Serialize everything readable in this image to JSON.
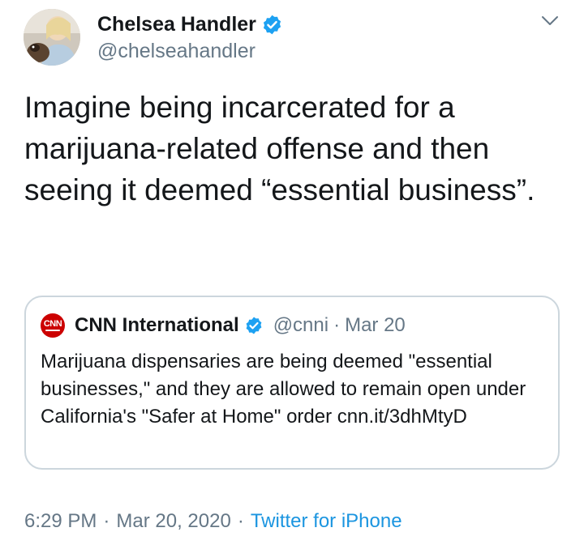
{
  "author": {
    "display_name": "Chelsea Handler",
    "handle": "@chelseahandler"
  },
  "tweet": {
    "text": "Imagine being incarcerated for a marijuana-related offense and then seeing it deemed “essential business”."
  },
  "quoted_tweet": {
    "display_name": "CNN International",
    "handle": "@cnni",
    "separator": "·",
    "date": "Mar 20",
    "logo_text": "CNN",
    "text": "Marijuana dispensaries are being deemed \"essential businesses,\" and they are allowed to remain open under California's \"Safer at Home\" order cnn.it/3dhMtyD"
  },
  "meta": {
    "time": "6:29 PM",
    "separator": "·",
    "date": "Mar 20, 2020",
    "source": "Twitter for iPhone"
  },
  "icons": {
    "verified": "verified-badge-icon",
    "menu": "chevron-down-icon"
  },
  "colors": {
    "verified_blue": "#1da1f2",
    "secondary_text": "#657786",
    "link_blue": "#1b95e0",
    "border": "#ccd6dd",
    "cnn_red": "#cc0000"
  }
}
